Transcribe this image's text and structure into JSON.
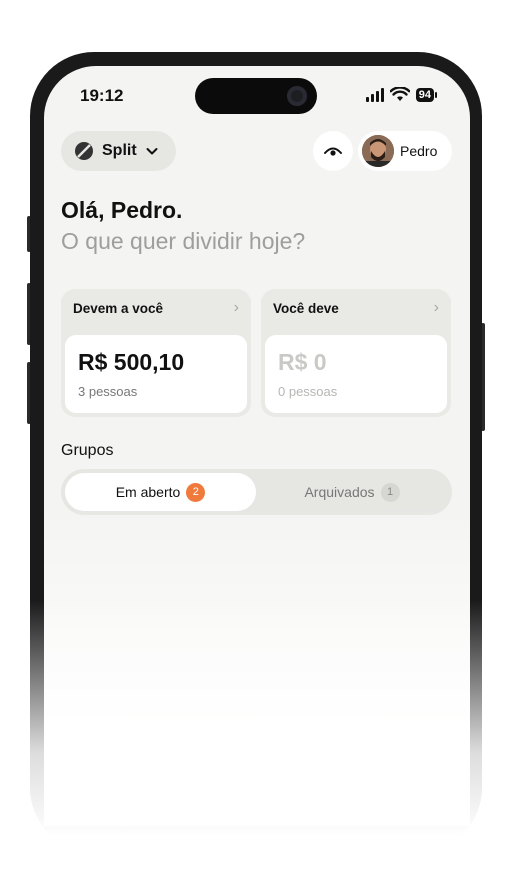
{
  "status_bar": {
    "time": "19:12",
    "battery": "94"
  },
  "header": {
    "app_selector_label": "Split",
    "user_name": "Pedro"
  },
  "greeting": {
    "hello": "Olá, Pedro.",
    "prompt": "O que quer dividir hoje?"
  },
  "cards": {
    "owed_to_you": {
      "title": "Devem a você",
      "amount": "R$ 500,10",
      "people": "3 pessoas"
    },
    "you_owe": {
      "title": "Você deve",
      "amount": "R$ 0",
      "people": "0 pessoas"
    }
  },
  "groups": {
    "title": "Grupos",
    "tabs": [
      {
        "label": "Em aberto",
        "count": "2"
      },
      {
        "label": "Arquivados",
        "count": "1"
      }
    ]
  },
  "colors": {
    "accent": "#f07a3c",
    "background": "#f4f4f2"
  }
}
